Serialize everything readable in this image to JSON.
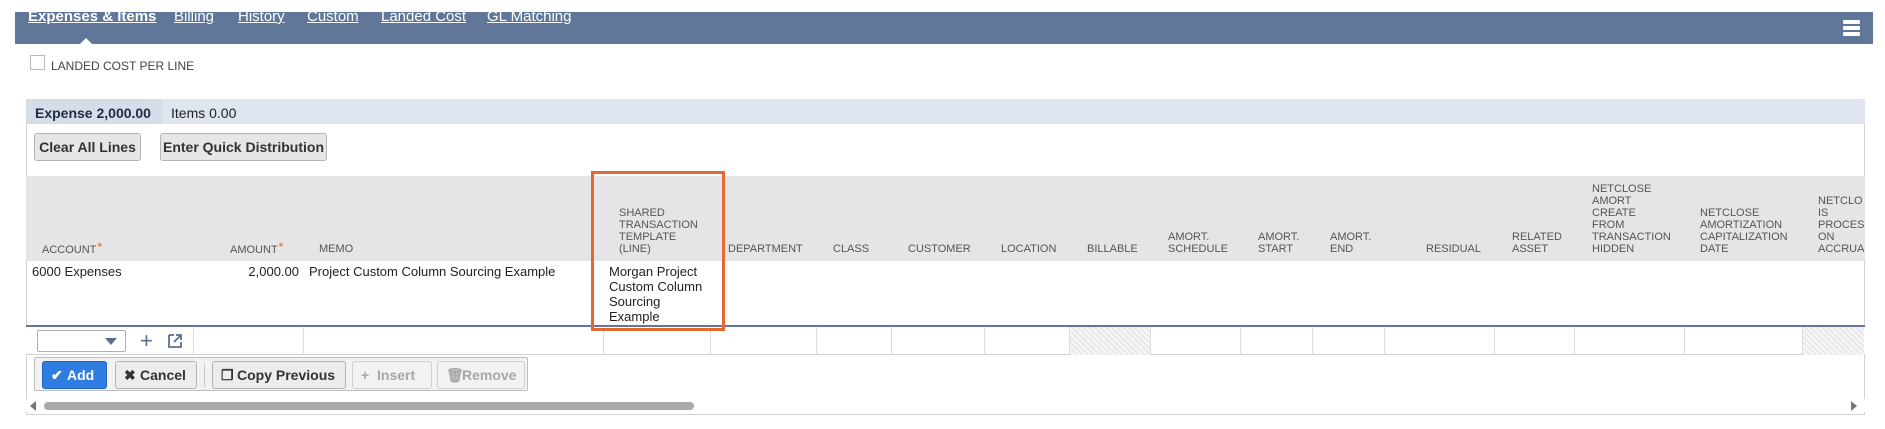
{
  "tabs": [
    {
      "label": "Expenses & Items",
      "active": true
    },
    {
      "label": "Billing"
    },
    {
      "label": "History"
    },
    {
      "label": "Custom"
    },
    {
      "label": "Landed Cost"
    },
    {
      "label": "GL Matching"
    }
  ],
  "landed_cost_label": "LANDED COST PER LINE",
  "subtabs": [
    {
      "label": "Expense 2,000.00",
      "active": true
    },
    {
      "label": "Items 0.00"
    }
  ],
  "buttons": {
    "clear": "Clear All Lines",
    "quick_dist": "Enter Quick Distribution"
  },
  "columns": {
    "account": "ACCOUNT",
    "amount": "AMOUNT",
    "memo": "MEMO",
    "shared_template": [
      "SHARED",
      "TRANSACTION",
      "TEMPLATE",
      "(LINE)"
    ],
    "department": "DEPARTMENT",
    "class": "CLASS",
    "customer": "CUSTOMER",
    "location": "LOCATION",
    "billable": "BILLABLE",
    "amort_schedule": [
      "AMORT.",
      "SCHEDULE"
    ],
    "amort_start": [
      "AMORT.",
      "START"
    ],
    "amort_end": [
      "AMORT.",
      "END"
    ],
    "residual": "RESIDUAL",
    "related_asset": [
      "RELATED",
      "ASSET"
    ],
    "netclose_hidden": [
      "NETCLOSE",
      "AMORT",
      "CREATE",
      "FROM",
      "TRANSACTION",
      "HIDDEN"
    ],
    "netclose_cap_date": [
      "NETCLOSE",
      "AMORTIZATION",
      "CAPITALIZATION",
      "DATE"
    ],
    "netclose_accrual": [
      "NETCLO",
      "IS",
      "PROCES",
      "ON",
      "ACCRUA"
    ],
    "required_mark": "*"
  },
  "row": {
    "account": "6000 Expenses",
    "amount": "2,000.00",
    "memo": "Project Custom Column Sourcing Example",
    "shared_template": [
      "Morgan Project",
      "Custom Column",
      "Sourcing",
      "Example"
    ]
  },
  "actions": {
    "add": "Add",
    "cancel": "Cancel",
    "copy_previous": "Copy Previous",
    "insert": "Insert",
    "remove": "Remove"
  },
  "colors": {
    "tabbar": "#607799",
    "highlight": "#e3692f",
    "primary": "#2f7de1",
    "required": "#e06a2c"
  }
}
